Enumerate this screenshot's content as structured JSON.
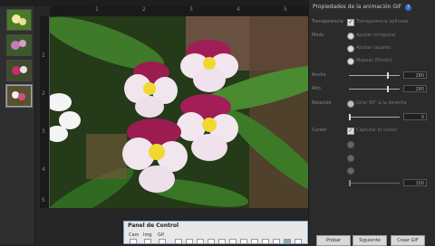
{
  "sidebar": {
    "thumbnails": [
      "thumb-1",
      "thumb-2",
      "thumb-3",
      "thumb-4"
    ],
    "selected_index": 3
  },
  "ruler": {
    "top_ticks": [
      "1",
      "2",
      "3",
      "4",
      "5"
    ],
    "left_ticks": [
      "1",
      "2",
      "3",
      "4",
      "5"
    ]
  },
  "canvas": {
    "image_alt": "orchid flowers"
  },
  "panel": {
    "title": "Propiedades de la animación GIF",
    "help_icon": "help-icon",
    "rows": [
      {
        "label": "Transparencia",
        "control": "checkbox",
        "text": "Transparencia aplicada"
      },
      {
        "label": "Modo",
        "control": "radio",
        "text": "Ajustar (ninguno)"
      },
      {
        "label": "",
        "control": "radio",
        "text": "Ajustar (ajuste)"
      },
      {
        "label": "",
        "control": "radio",
        "text": "Mapear (Fondo)"
      },
      {
        "label": "Ancho",
        "control": "slider",
        "value": "280",
        "level": 0.75
      },
      {
        "label": "Alto",
        "control": "slider",
        "value": "280",
        "level": 0.75
      },
      {
        "label": "Rotación",
        "control": "radio",
        "text": "Girar 90° a la derecha"
      },
      {
        "label": "",
        "control": "slider",
        "value": "0",
        "level": 0.0
      },
      {
        "label": "Cursor",
        "control": "checkbox",
        "text": "Capturar el cursor"
      },
      {
        "label": "",
        "control": "radio",
        "text": ""
      },
      {
        "label": "",
        "control": "radio",
        "text": ""
      },
      {
        "label": "",
        "control": "radio",
        "text": ""
      },
      {
        "label": "",
        "control": "slider",
        "value": "100",
        "level": 1.0
      }
    ],
    "buttons": {
      "preview": "Probar",
      "next": "Siguiente",
      "create": "Crear GIF"
    }
  },
  "control_panel": {
    "title": "Panel de Control",
    "tabs": [
      "Cam",
      "Img",
      "Gif"
    ]
  }
}
